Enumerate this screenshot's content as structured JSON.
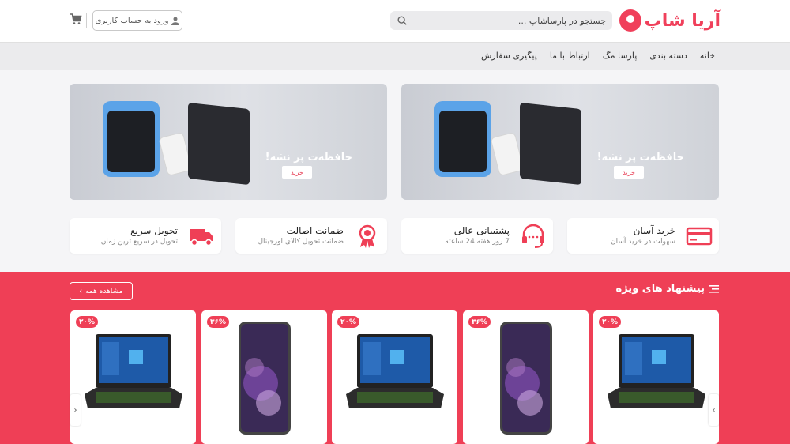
{
  "header": {
    "logo_text": "آریا شاپ",
    "search_placeholder": "جستجو در پارساشاپ ...",
    "login_label": "ورود به حساب کاربری"
  },
  "nav": {
    "items": [
      "خانه",
      "دسته بندی",
      "پارسا مگ",
      "ارتباط با ما",
      "پیگیری سفارش"
    ]
  },
  "banners": [
    {
      "title": "حافظه‌ت پر نشه!",
      "button": "خرید"
    },
    {
      "title": "حافظه‌ت پر نشه!",
      "button": "خرید"
    }
  ],
  "features": [
    {
      "title": "خرید آسان",
      "subtitle": "سهولت در خرید آسان",
      "icon": "card-icon"
    },
    {
      "title": "پشتیبانی عالی",
      "subtitle": "7 روز هفته 24 ساعته",
      "icon": "headset-icon"
    },
    {
      "title": "ضمانت اصالت",
      "subtitle": "ضمانت تحویل کالای اورجینال",
      "icon": "award-icon"
    },
    {
      "title": "تحویل سریع",
      "subtitle": "تحویل در سریع ترین زمان",
      "icon": "truck-icon"
    }
  ],
  "offers": {
    "title": "پیشنهاد های ویژه",
    "see_all": "مشاهده همه",
    "products": [
      {
        "discount": "۲۰%",
        "type": "laptop"
      },
      {
        "discount": "۳۶%",
        "type": "phone"
      },
      {
        "discount": "۲۰%",
        "type": "laptop"
      },
      {
        "discount": "۳۶%",
        "type": "phone"
      },
      {
        "discount": "۲۰%",
        "type": "laptop"
      }
    ]
  },
  "colors": {
    "accent": "#ef3f56",
    "nav_bg": "#ebebed"
  }
}
